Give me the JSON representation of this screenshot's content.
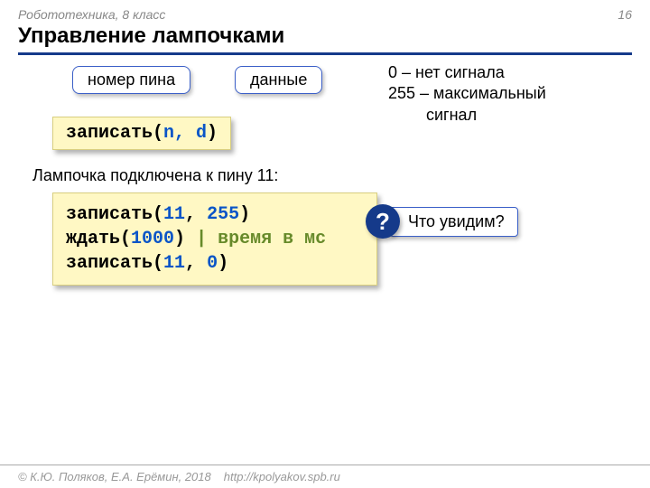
{
  "header": {
    "course": "Робототехника, 8 класс",
    "page": "16"
  },
  "title": "Управление лампочками",
  "pills": {
    "pin": "номер пина",
    "data": "данные"
  },
  "signal": {
    "line1": "0 – нет сигнала",
    "line2a": "255 – максимальный",
    "line2b": "сигнал"
  },
  "code1": {
    "fn": "записать",
    "open": "(",
    "args": "n, d",
    "close": ")"
  },
  "subtext": "Лампочка подключена к пину 11:",
  "code2": {
    "l1_fn": "записать",
    "l1_a": "11",
    "l1_sep": ", ",
    "l1_b": "255",
    "l2_fn": "ждать",
    "l2_a": "1000",
    "l2_comment": " | время в мс",
    "l3_fn": "записать",
    "l3_a": "11",
    "l3_sep": ", ",
    "l3_b": "0"
  },
  "question": {
    "mark": "?",
    "text": "Что увидим?"
  },
  "footer": {
    "copyright": "© К.Ю. Поляков, Е.А. Ерёмин, 2018",
    "url": "http://kpolyakov.spb.ru"
  }
}
